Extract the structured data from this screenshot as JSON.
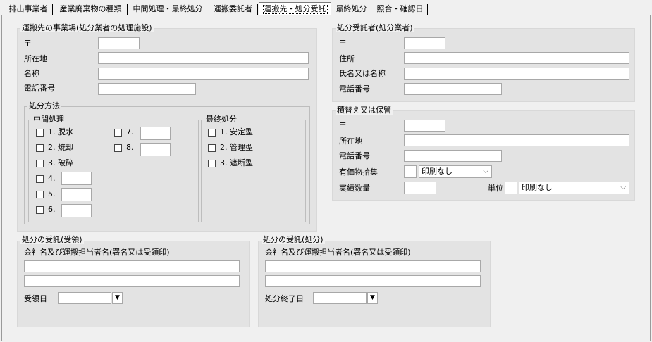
{
  "tabs": [
    "排出事業者",
    "産業廃棄物の種類",
    "中間処理・最終処分",
    "運搬委託者",
    "運搬先・処分受託",
    "最終処分",
    "照合・確認日"
  ],
  "transport_dest": {
    "legend": "運搬先の事業場(処分業者の処理施設)",
    "postal": "〒",
    "address": "所在地",
    "name": "名称",
    "phone": "電話番号"
  },
  "disposal_method": {
    "legend": "処分方法",
    "intermediate": {
      "legend": "中間処理",
      "items": [
        "1. 脱水",
        "2. 焼却",
        "3. 破砕",
        "4.",
        "5.",
        "6.",
        "7.",
        "8."
      ]
    },
    "final": {
      "legend": "最終処分",
      "items": [
        "1. 安定型",
        "2. 管理型",
        "3. 遮断型"
      ]
    }
  },
  "disposal_contractor": {
    "legend": "処分受託者(処分業者)",
    "postal": "〒",
    "address": "住所",
    "name": "氏名又は名称",
    "phone": "電話番号"
  },
  "transfer_storage": {
    "legend": "積替え又は保管",
    "postal": "〒",
    "address": "所在地",
    "phone": "電話番号",
    "valuables": "有価物拾集",
    "valuables_select": "印刷なし",
    "actual_qty": "実績数量",
    "unit": "単位",
    "unit_select": "印刷なし"
  },
  "receipt_collection": {
    "legend": "処分の受託(受領)",
    "company_label": "会社名及び運搬担当者名(署名又は受領印)",
    "date_label": "受領日"
  },
  "receipt_disposal": {
    "legend": "処分の受託(処分)",
    "company_label": "会社名及び運搬担当者名(署名又は受領印)",
    "date_label": "処分終了日"
  }
}
